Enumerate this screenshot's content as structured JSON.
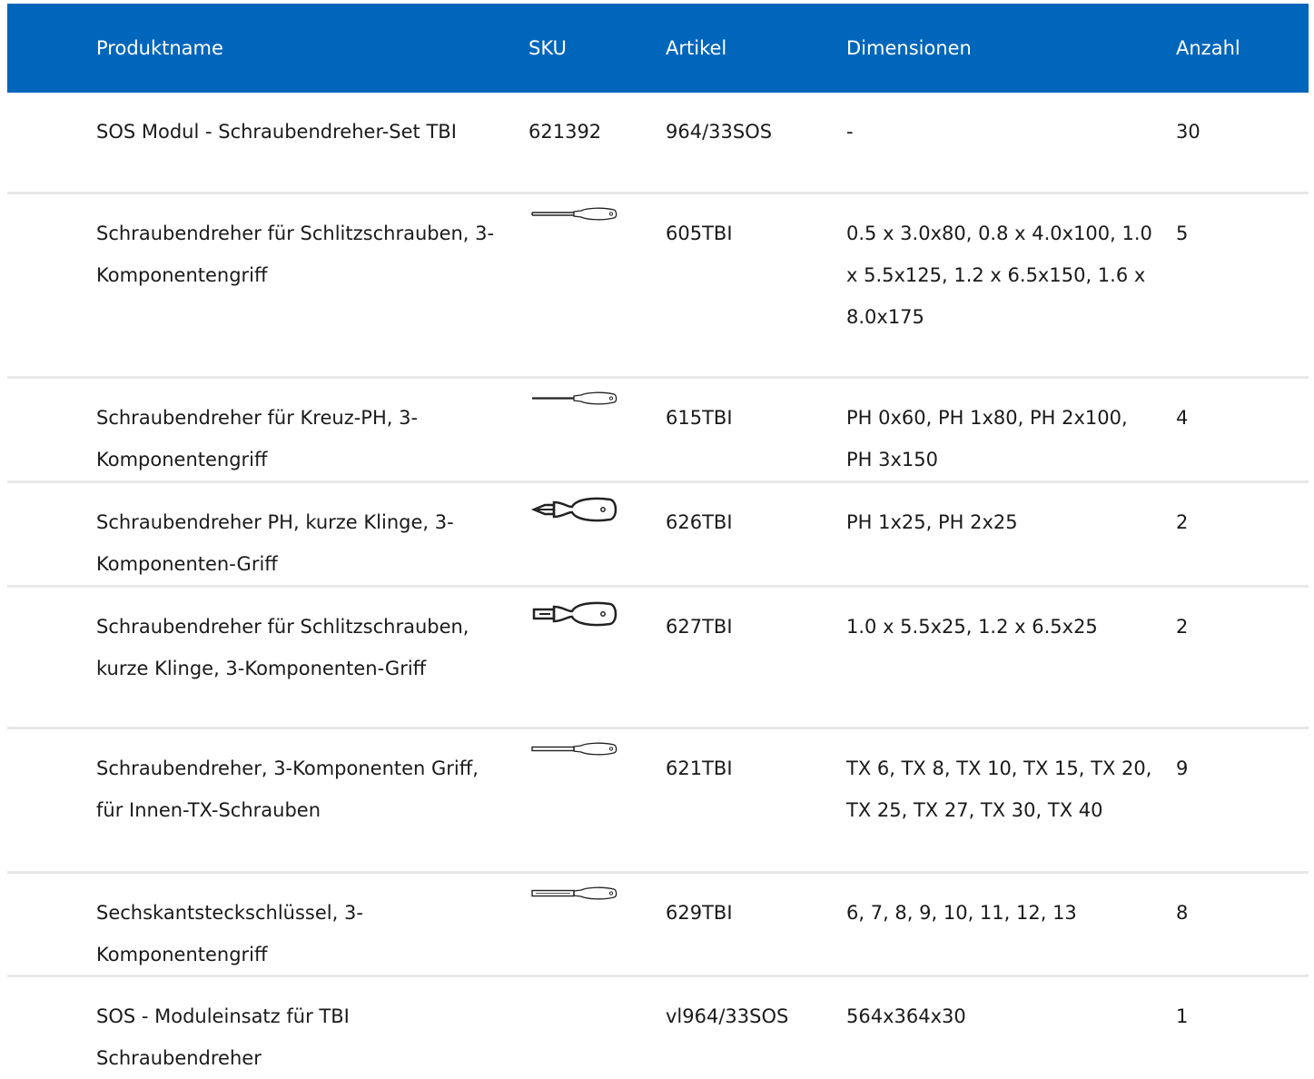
{
  "header": {
    "name": "Produktname",
    "sku": "SKU",
    "article": "Artikel",
    "dimensions": "Dimensionen",
    "quantity": "Anzahl"
  },
  "rows": [
    {
      "name": "SOS Modul - Schraubendreher-Set TBI",
      "sku": "621392",
      "icon": "",
      "article": "964/33SOS",
      "dimensions": "-",
      "quantity": "30"
    },
    {
      "name": "Schraubendreher für Schlitzschrauben, 3-Komponentengriff",
      "sku": "",
      "icon": "slotted-screwdriver-icon",
      "article": "605TBI",
      "dimensions": "0.5 x 3.0x80, 0.8 x 4.0x100, 1.0 x 5.5x125, 1.2 x 6.5x150, 1.6 x 8.0x175",
      "quantity": "5"
    },
    {
      "name": "Schraubendreher für Kreuz-PH, 3-Komponentengriff",
      "sku": "",
      "icon": "phillips-screwdriver-icon",
      "article": "615TBI",
      "dimensions": "PH 0x60, PH 1x80, PH 2x100, PH 3x150",
      "quantity": "4"
    },
    {
      "name": "Schraubendreher PH, kurze Klinge, 3-Komponenten-Griff",
      "sku": "",
      "icon": "stubby-phillips-screwdriver-icon",
      "article": "626TBI",
      "dimensions": "PH 1x25, PH 2x25",
      "quantity": "2"
    },
    {
      "name": "Schraubendreher für Schlitzschrauben, kurze Klinge, 3-Komponenten-Griff",
      "sku": "",
      "icon": "stubby-slotted-screwdriver-icon",
      "article": "627TBI",
      "dimensions": "1.0 x 5.5x25, 1.2 x 6.5x25",
      "quantity": "2"
    },
    {
      "name": "Schraubendreher, 3-Komponenten Griff, für Innen-TX-Schrauben",
      "sku": "",
      "icon": "torx-screwdriver-icon",
      "article": "621TBI",
      "dimensions": "TX 6, TX 8, TX 10, TX 15, TX 20, TX 25, TX 27, TX 30, TX 40",
      "quantity": "9"
    },
    {
      "name": "Sechskantsteckschlüssel, 3-Komponentengriff",
      "sku": "",
      "icon": "hex-nut-driver-icon",
      "article": "629TBI",
      "dimensions": "6, 7, 8, 9, 10, 11, 12, 13",
      "quantity": "8"
    },
    {
      "name": "SOS - Moduleinsatz für TBI Schraubendreher",
      "sku": "",
      "icon": "",
      "article": "vl964/33SOS",
      "dimensions": "564x364x30",
      "quantity": "1"
    }
  ]
}
